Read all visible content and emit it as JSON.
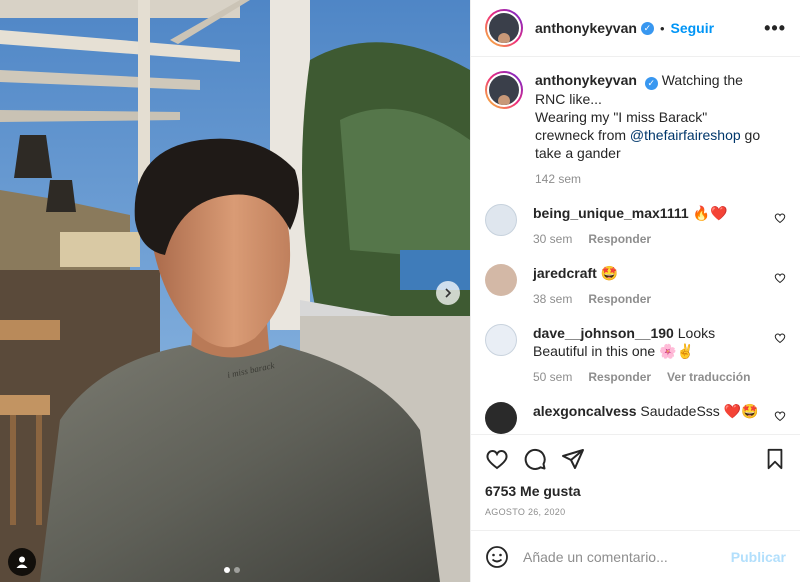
{
  "post": {
    "username": "anthonykeyvan",
    "verified_mark": "✓",
    "separator": "•",
    "follow_label": "Seguir",
    "more_label": "•••",
    "caption_lines": {
      "text1": "Watching the RNC like...",
      "text2": "Wearing my \"I miss Barack\" crewneck from ",
      "mention": "@thefairfaireshop",
      "text3": " go take a gander"
    },
    "caption_time": "142 sem",
    "photo_dots": 2,
    "sweater_text": "i miss barack"
  },
  "comments": [
    {
      "username": "being_unique_max1111",
      "text": "🔥❤️",
      "time": "30 sem",
      "reply": "Responder",
      "translate": ""
    },
    {
      "username": "jaredcraft",
      "text": "🤩",
      "time": "38 sem",
      "reply": "Responder",
      "translate": ""
    },
    {
      "username": "dave__johnson__190",
      "text": "Looks Beautiful in this one 🌸✌",
      "time": "50 sem",
      "reply": "Responder",
      "translate": "Ver traducción"
    },
    {
      "username": "alexgoncalvess",
      "text": "SaudadeSss ❤️🤩",
      "time": "",
      "reply": "",
      "translate": ""
    }
  ],
  "actions": {
    "likes": "6753 Me gusta",
    "date": "AGOSTO 26, 2020"
  },
  "composer": {
    "placeholder": "Añade un comentario...",
    "post_label": "Publicar"
  },
  "icons": [
    "heart-icon",
    "comment-icon",
    "share-icon",
    "bookmark-icon",
    "emoji-icon",
    "chevron-right-icon",
    "user-tag-icon"
  ],
  "colors": {
    "accent": "#0095f6",
    "verified": "#3897f0",
    "like_red": "#ed4956"
  }
}
